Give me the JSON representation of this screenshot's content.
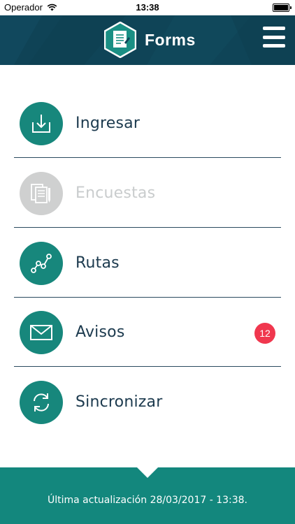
{
  "status_bar": {
    "carrier": "Operador",
    "time": "13:38"
  },
  "header": {
    "title": "Forms",
    "logo_icon": "forms-hexagon-logo",
    "menu_icon": "hamburger-menu-icon"
  },
  "menu": {
    "items": [
      {
        "label": "Ingresar",
        "icon": "download-tray-icon",
        "enabled": true
      },
      {
        "label": "Encuestas",
        "icon": "survey-forms-icon",
        "enabled": false
      },
      {
        "label": "Rutas",
        "icon": "route-path-icon",
        "enabled": true
      },
      {
        "label": "Avisos",
        "icon": "envelope-icon",
        "enabled": true,
        "badge": "12"
      },
      {
        "label": "Sincronizar",
        "icon": "sync-arrows-icon",
        "enabled": true
      }
    ]
  },
  "footer": {
    "text": "Última actualización 28/03/2017 - 13:38."
  },
  "colors": {
    "header_bg": "#0f4457",
    "accent_teal": "#17877c",
    "disabled_gray": "#cfd0d0",
    "badge_red": "#f0374e",
    "divider": "#2a4a5e"
  }
}
